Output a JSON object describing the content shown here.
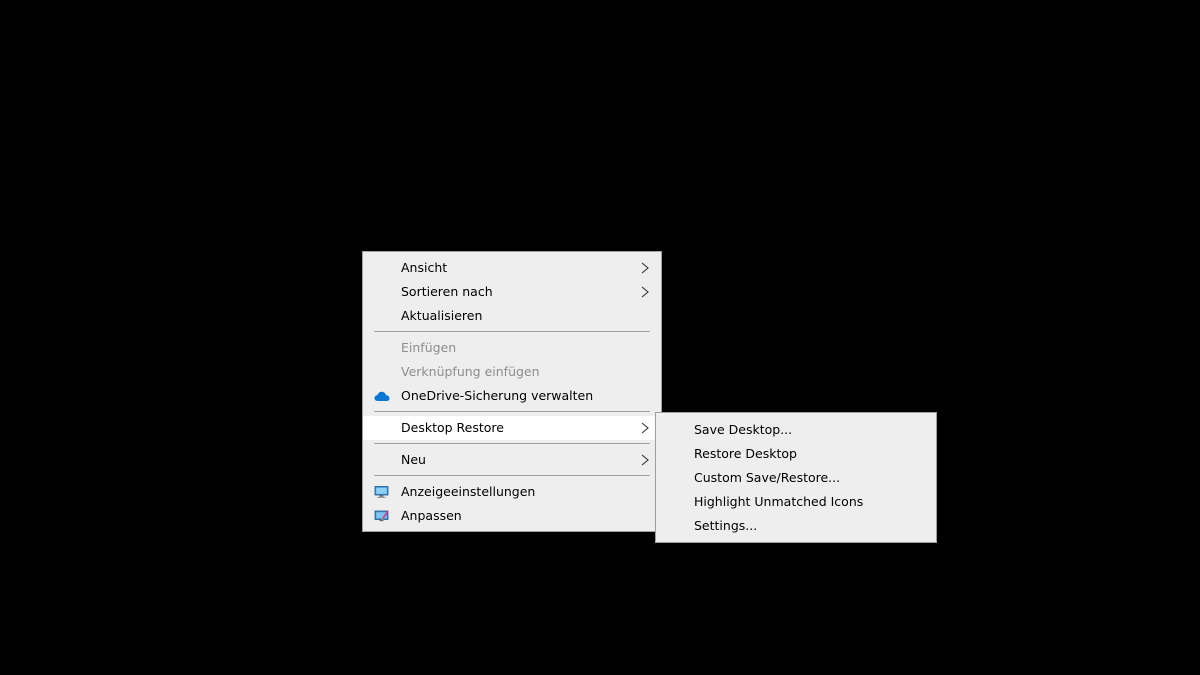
{
  "context_menu": {
    "items": [
      {
        "label": "Ansicht"
      },
      {
        "label": "Sortieren nach"
      },
      {
        "label": "Aktualisieren"
      },
      {
        "label": "Einfügen"
      },
      {
        "label": "Verknüpfung einfügen"
      },
      {
        "label": "OneDrive-Sicherung verwalten",
        "icon": "onedrive-cloud-icon"
      },
      {
        "label": "Desktop Restore"
      },
      {
        "label": "Neu"
      },
      {
        "label": "Anzeigeeinstellungen",
        "icon": "display-settings-icon"
      },
      {
        "label": "Anpassen",
        "icon": "personalize-icon"
      }
    ]
  },
  "submenu": {
    "items": [
      {
        "label": "Save Desktop..."
      },
      {
        "label": "Restore Desktop"
      },
      {
        "label": "Custom Save/Restore..."
      },
      {
        "label": "Highlight Unmatched Icons"
      },
      {
        "label": "Settings..."
      }
    ]
  },
  "colors": {
    "desktop_background": "#000000",
    "menu_background": "#eeeeee",
    "highlight": "#ffffff",
    "disabled_text": "#8d8d8d",
    "onedrive_blue": "#0a78d4"
  }
}
